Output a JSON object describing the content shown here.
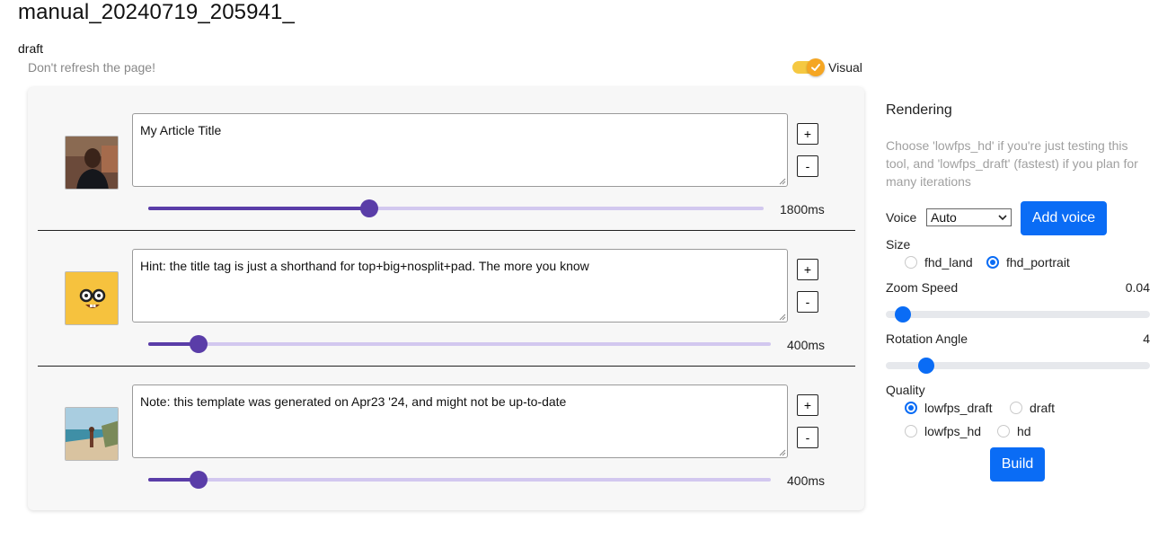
{
  "page": {
    "title": "manual_20240719_205941_"
  },
  "status": {
    "mode": "draft",
    "warning": "Don't refresh the page!"
  },
  "visual_toggle": {
    "label": "Visual",
    "on": true
  },
  "editor": {
    "rows": [
      {
        "text": "My Article Title",
        "duration": "1800ms",
        "duration_ms": 1800,
        "avatar": "person-photo"
      },
      {
        "text": "Hint: the title tag is just a shorthand for top+big+nosplit+pad. The more you know",
        "duration": "400ms",
        "duration_ms": 400,
        "avatar": "nerd-face-emoji"
      },
      {
        "text": "Note: this template was generated on Apr23 '24, and might not be up-to-date",
        "duration": "400ms",
        "duration_ms": 400,
        "avatar": "beach-photo"
      }
    ],
    "add_label": "+",
    "remove_label": "-"
  },
  "rendering": {
    "heading": "Rendering",
    "hint": "Choose 'lowfps_hd' if you're just testing this tool, and 'lowfps_draft' (fastest) if you plan for many iterations",
    "voice": {
      "label": "Voice",
      "selected": "Auto",
      "add_button": "Add voice"
    },
    "size": {
      "label": "Size",
      "options": [
        "fhd_land",
        "fhd_portrait"
      ],
      "selected": "fhd_portrait"
    },
    "zoom_speed": {
      "label": "Zoom Speed",
      "value": "0.04"
    },
    "rotation_angle": {
      "label": "Rotation Angle",
      "value": "4"
    },
    "quality": {
      "label": "Quality",
      "options": [
        "lowfps_draft",
        "draft",
        "lowfps_hd",
        "hd"
      ],
      "selected": "lowfps_draft"
    },
    "build_button": "Build"
  },
  "colors": {
    "accent_blue": "#0a6cf5",
    "slider_purple": "#5a3da8",
    "toggle_yellow": "#f5a623"
  }
}
